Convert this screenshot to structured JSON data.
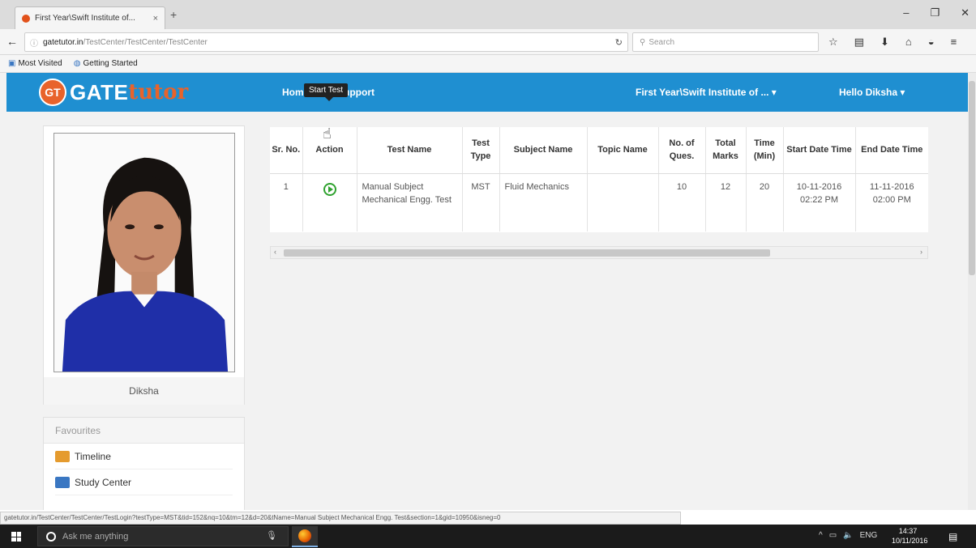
{
  "browser": {
    "tab_title": "First Year\\Swift Institute of...",
    "tab_close": "×",
    "new_tab": "+",
    "url_host": "gatetutor.in",
    "url_path": "/TestCenter/TestCenter/TestCenter",
    "search_placeholder": "Search",
    "bookmarks": [
      "Most Visited",
      "Getting Started"
    ],
    "status_url": "gatetutor.in/TestCenter/TestCenter/TestLogin?testType=MST&tid=152&nq=10&tm=12&d=20&tName=Manual Subject Mechanical Engg. Test&section=1&gid=10950&isneg=0"
  },
  "header": {
    "logo_badge": "GT",
    "logo_gate": "GATE",
    "logo_tutor": "tutor",
    "nav": [
      "Home",
      "Support"
    ],
    "institute_menu": "First Year\\Swift Institute of ... ▾",
    "user_menu": "Hello Diksha ▾"
  },
  "sidebar": {
    "profile_name": "Diksha",
    "favourites_title": "Favourites",
    "favourites": [
      {
        "label": "Timeline",
        "icon": "timeline-icon",
        "color": "#e59b2e"
      },
      {
        "label": "Study Center",
        "icon": "study-center-icon",
        "color": "#3a77c2"
      }
    ]
  },
  "table": {
    "columns": [
      "Sr. No.",
      "Action",
      "Test Name",
      "Test Type",
      "Subject Name",
      "Topic Name",
      "No. of Ques.",
      "Total Marks",
      "Time (Min)",
      "Start Date Time",
      "End Date Time"
    ],
    "rows": [
      {
        "sr": "1",
        "action": "play-circle-icon",
        "test_name": "Manual Subject Mechanical Engg. Test",
        "test_type": "MST",
        "subject": "Fluid Mechanics",
        "topic": "",
        "questions": "10",
        "marks": "12",
        "time": "20",
        "start": "10-11-2016 02:22 PM",
        "end": "11-11-2016 02:00 PM"
      }
    ],
    "tooltip": "Start Test"
  },
  "taskbar": {
    "search_placeholder": "Ask me anything",
    "tray_lang": "ENG",
    "time": "14:37",
    "date": "10/11/2016"
  },
  "colors": {
    "header_bg": "#1f8fd1",
    "accent_orange": "#e8632b",
    "play_green": "#2fa22f"
  }
}
